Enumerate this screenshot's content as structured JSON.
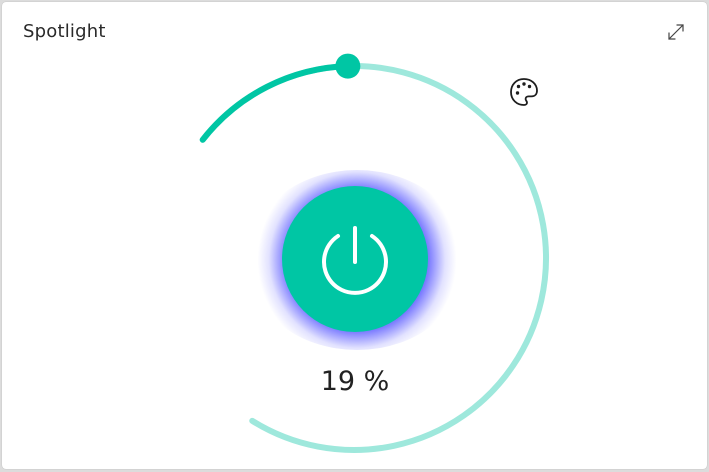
{
  "widget": {
    "title": "Spotlight",
    "brightness_percent": 19,
    "brightness_label": "19 %",
    "icons": {
      "expand": "expand-icon",
      "palette": "palette-icon",
      "power": "power-icon"
    }
  },
  "colors": {
    "accent": "#00c6a4",
    "track": "#9ee8dc",
    "glow": "#2323ff",
    "card": "#ffffff"
  }
}
